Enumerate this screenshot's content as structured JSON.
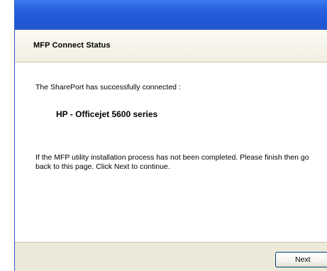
{
  "header": {
    "title": "MFP Connect Status"
  },
  "main": {
    "status_text": "The SharePort has successfully connected :",
    "device_name": "HP - Officejet 5600 series",
    "instruction_text": "If the MFP utility installation process has not been completed. Please finish then go back to this page. Click Next to continue."
  },
  "footer": {
    "next_label": "Next"
  }
}
